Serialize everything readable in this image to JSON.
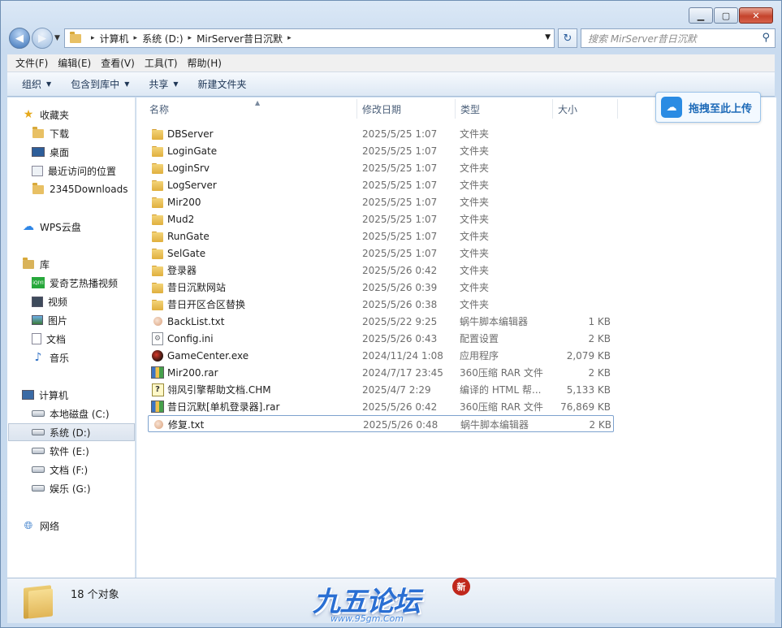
{
  "window": {
    "minimize_label": "▁",
    "maximize_label": "▢",
    "close_label": "✕"
  },
  "nav": {
    "back_glyph": "◀",
    "forward_glyph": "▶",
    "refresh_glyph": "↻",
    "address": {
      "crumbs": [
        "计算机",
        "系统 (D:)",
        "MirServer昔日沉默"
      ]
    },
    "search_placeholder": "搜索 MirServer昔日沉默"
  },
  "menu": [
    "文件(F)",
    "编辑(E)",
    "查看(V)",
    "工具(T)",
    "帮助(H)"
  ],
  "toolbar": {
    "organize": "组织",
    "include_library": "包含到库中",
    "share": "共享",
    "new_folder": "新建文件夹"
  },
  "upload": {
    "label": "拖拽至此上传",
    "icon": "cloud-upload-icon"
  },
  "sidebar": {
    "favorites_header": "收藏夹",
    "favorites": [
      "下载",
      "桌面",
      "最近访问的位置",
      "2345Downloads"
    ],
    "wps": "WPS云盘",
    "library_header": "库",
    "libraries": [
      "爱奇艺热播视频",
      "视频",
      "图片",
      "文档",
      "音乐"
    ],
    "computer_header": "计算机",
    "drives": [
      "本地磁盘 (C:)",
      "系统 (D:)",
      "软件 (E:)",
      "文档 (F:)",
      "娱乐 (G:)"
    ],
    "network": "网络"
  },
  "columns": {
    "name": "名称",
    "date": "修改日期",
    "type": "类型",
    "size": "大小"
  },
  "files": [
    {
      "name": "DBServer",
      "date": "2025/5/25 1:07",
      "type": "文件夹",
      "size": "",
      "icon": "folder"
    },
    {
      "name": "LoginGate",
      "date": "2025/5/25 1:07",
      "type": "文件夹",
      "size": "",
      "icon": "folder"
    },
    {
      "name": "LoginSrv",
      "date": "2025/5/25 1:07",
      "type": "文件夹",
      "size": "",
      "icon": "folder"
    },
    {
      "name": "LogServer",
      "date": "2025/5/25 1:07",
      "type": "文件夹",
      "size": "",
      "icon": "folder"
    },
    {
      "name": "Mir200",
      "date": "2025/5/25 1:07",
      "type": "文件夹",
      "size": "",
      "icon": "folder"
    },
    {
      "name": "Mud2",
      "date": "2025/5/25 1:07",
      "type": "文件夹",
      "size": "",
      "icon": "folder"
    },
    {
      "name": "RunGate",
      "date": "2025/5/25 1:07",
      "type": "文件夹",
      "size": "",
      "icon": "folder"
    },
    {
      "name": "SelGate",
      "date": "2025/5/25 1:07",
      "type": "文件夹",
      "size": "",
      "icon": "folder"
    },
    {
      "name": "登录器",
      "date": "2025/5/26 0:42",
      "type": "文件夹",
      "size": "",
      "icon": "folder"
    },
    {
      "name": "昔日沉默网站",
      "date": "2025/5/26 0:39",
      "type": "文件夹",
      "size": "",
      "icon": "folder"
    },
    {
      "name": "昔日开区合区替换",
      "date": "2025/5/26 0:38",
      "type": "文件夹",
      "size": "",
      "icon": "folder"
    },
    {
      "name": "BackList.txt",
      "date": "2025/5/22 9:25",
      "type": "蜗牛脚本编辑器",
      "size": "1 KB",
      "icon": "txt"
    },
    {
      "name": "Config.ini",
      "date": "2025/5/26 0:43",
      "type": "配置设置",
      "size": "2 KB",
      "icon": "ini"
    },
    {
      "name": "GameCenter.exe",
      "date": "2024/11/24 1:08",
      "type": "应用程序",
      "size": "2,079 KB",
      "icon": "exe"
    },
    {
      "name": "Mir200.rar",
      "date": "2024/7/17 23:45",
      "type": "360压缩 RAR 文件",
      "size": "2 KB",
      "icon": "rar"
    },
    {
      "name": "翎风引擎帮助文档.CHM",
      "date": "2025/4/7 2:29",
      "type": "编译的 HTML 帮...",
      "size": "5,133 KB",
      "icon": "chm"
    },
    {
      "name": "昔日沉默[单机登录器].rar",
      "date": "2025/5/26 0:42",
      "type": "360压缩 RAR 文件",
      "size": "76,869 KB",
      "icon": "rar"
    },
    {
      "name": "修复.txt",
      "date": "2025/5/26 0:48",
      "type": "蜗牛脚本编辑器",
      "size": "2 KB",
      "icon": "txt",
      "selected": true
    }
  ],
  "status": {
    "count": "18 个对象"
  },
  "watermark": {
    "logo": "九五论坛",
    "url": "www.95gm.Com",
    "seal": "新"
  }
}
